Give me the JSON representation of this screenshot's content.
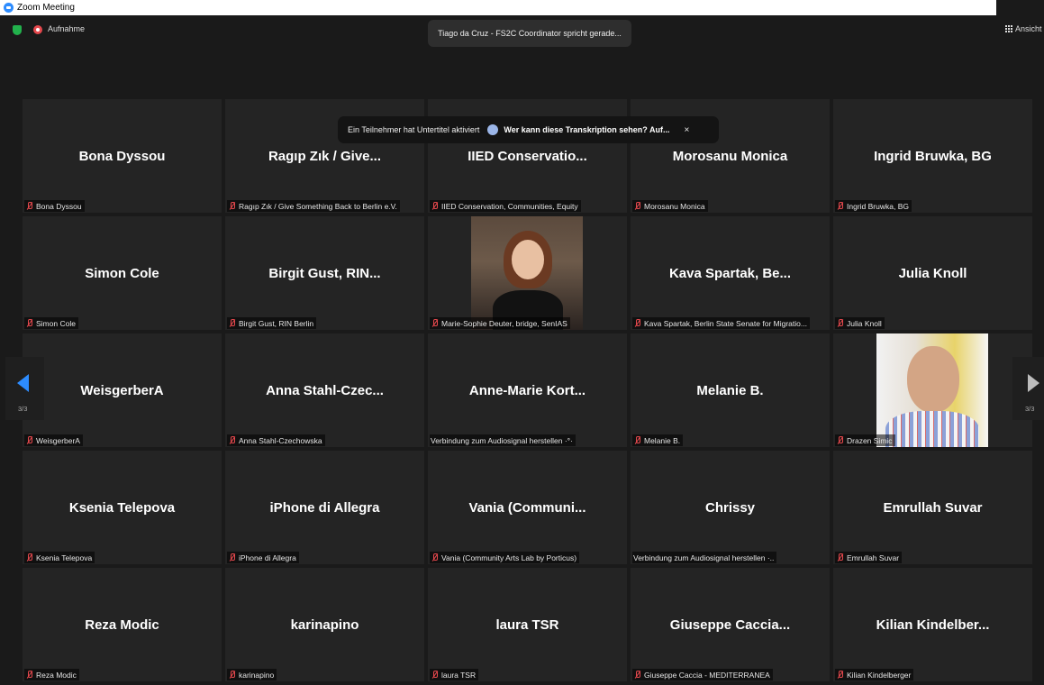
{
  "window": {
    "title": "Zoom Meeting"
  },
  "topbar": {
    "recording_label": "Aufnahme",
    "speaker_status": "Tiago da Cruz - FS2C Coordinator spricht gerade...",
    "view_label": "Ansicht"
  },
  "caption_banner": {
    "text": "Ein Teilnehmer hat Untertitel aktiviert",
    "link": "Wer kann diese Transkription sehen? Auf...",
    "close": "×"
  },
  "pagination": {
    "left": "3/3",
    "right": "3/3"
  },
  "tiles": [
    {
      "name": "Bona Dyssou",
      "label": "Bona Dyssou",
      "muted": true
    },
    {
      "name": "Ragıp Zık / Give...",
      "label": "Ragıp Zık / Give Something Back to Berlin e.V.",
      "muted": true
    },
    {
      "name": "IIED Conservatio...",
      "label": "IIED Conservation, Communities, Equity",
      "muted": true
    },
    {
      "name": "Morosanu Monica",
      "label": "Morosanu Monica",
      "muted": true
    },
    {
      "name": "Ingrid Bruwka, BG",
      "label": "Ingrid Bruwka, BG",
      "muted": true
    },
    {
      "name": "Simon Cole",
      "label": "Simon Cole",
      "muted": true
    },
    {
      "name": "Birgit Gust, RIN...",
      "label": "Birgit Gust, RIN Berlin",
      "muted": true
    },
    {
      "name": "",
      "label": "Marie-Sophie Deuter, bridge, SenIAS",
      "muted": true,
      "photo": "woman"
    },
    {
      "name": "Kava Spartak, Be...",
      "label": "Kava Spartak, Berlin State Senate for Migratio...",
      "muted": true
    },
    {
      "name": "Julia Knoll",
      "label": "Julia Knoll",
      "muted": true
    },
    {
      "name": "WeisgerberA",
      "label": "WeisgerberA",
      "muted": true
    },
    {
      "name": "Anna Stahl-Czec...",
      "label": "Anna Stahl-Czechowska",
      "muted": true
    },
    {
      "name": "Anne-Marie Kort...",
      "label": "Verbindung zum Audiosignal herstellen ·°·",
      "muted": false
    },
    {
      "name": "Melanie B.",
      "label": "Melanie B.",
      "muted": true
    },
    {
      "name": "",
      "label": "Drazen Simic",
      "muted": true,
      "photo": "man"
    },
    {
      "name": "Ksenia Telepova",
      "label": "Ksenia Telepova",
      "muted": true
    },
    {
      "name": "iPhone di Allegra",
      "label": "iPhone di Allegra",
      "muted": true
    },
    {
      "name": "Vania  (Communi...",
      "label": "Vania (Community Arts Lab by Porticus)",
      "muted": true
    },
    {
      "name": "Chrissy",
      "label": "Verbindung zum Audiosignal herstellen ·..",
      "muted": false
    },
    {
      "name": "Emrullah Suvar",
      "label": "Emrullah Suvar",
      "muted": true
    },
    {
      "name": "Reza Modic",
      "label": "Reza Modic",
      "muted": true
    },
    {
      "name": "karinapino",
      "label": "karinapino",
      "muted": true
    },
    {
      "name": "laura TSR",
      "label": "laura TSR",
      "muted": true
    },
    {
      "name": "Giuseppe Caccia...",
      "label": "Giuseppe Caccia - MEDITERRANEA",
      "muted": true
    },
    {
      "name": "Kilian  Kindelber...",
      "label": "Kilian Kindelberger",
      "muted": true
    }
  ],
  "colors": {
    "accent": "#2d8cff",
    "muted": "#e5484d",
    "secure": "#22b14c",
    "tile_bg": "#242424"
  },
  "icons": {
    "shield": "shield-icon",
    "recording": "record-icon",
    "view": "grid-icon",
    "muted": "mic-muted-icon"
  }
}
